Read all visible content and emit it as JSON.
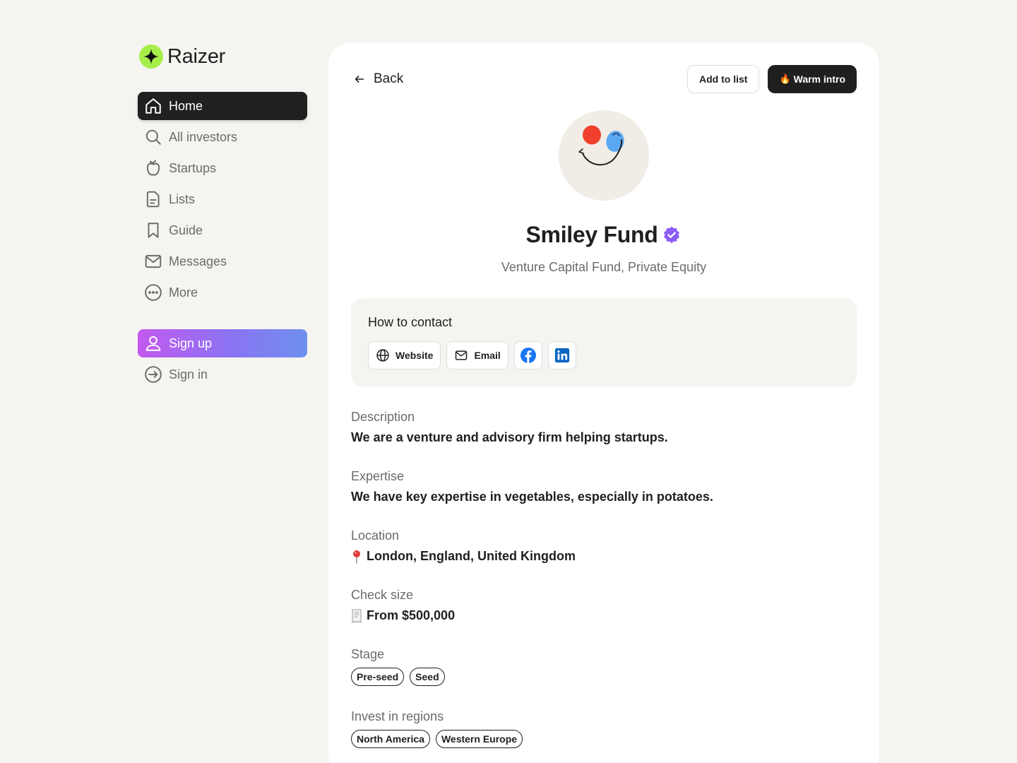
{
  "brand": {
    "name": "Raizer",
    "accent": "#a6ef4a"
  },
  "nav": {
    "items": [
      {
        "label": "Home",
        "icon": "home-icon"
      },
      {
        "label": "All investors",
        "icon": "search-icon"
      },
      {
        "label": "Startups",
        "icon": "apple-icon"
      },
      {
        "label": "Lists",
        "icon": "document-icon"
      },
      {
        "label": "Guide",
        "icon": "bookmark-icon"
      },
      {
        "label": "Messages",
        "icon": "mail-icon"
      },
      {
        "label": "More",
        "icon": "more-icon"
      }
    ],
    "signup_label": "Sign up",
    "signin_label": "Sign in"
  },
  "topbar": {
    "back_label": "Back",
    "add_to_list_label": "Add to list",
    "warm_intro_label": "Warm intro"
  },
  "profile": {
    "name": "Smiley Fund",
    "subtitle": "Venture Capital Fund, Private Equity",
    "verified_color": "#8b5cf6"
  },
  "contact": {
    "title": "How to contact",
    "website_label": "Website",
    "email_label": "Email",
    "facebook_color": "#1877f2",
    "linkedin_color": "#0a66c2"
  },
  "details": {
    "description_label": "Description",
    "description": "We are a venture and advisory firm helping startups.",
    "expertise_label": "Expertise",
    "expertise": "We have key expertise in vegetables, especially in potatoes.",
    "location_label": "Location",
    "location": "London, England, United Kingdom",
    "check_size_label": "Check size",
    "check_size": "From $500,000",
    "stage_label": "Stage",
    "stages": [
      "Pre-seed",
      "Seed"
    ],
    "regions_label": "Invest in regions",
    "regions": [
      "North America",
      "Western Europe"
    ]
  }
}
